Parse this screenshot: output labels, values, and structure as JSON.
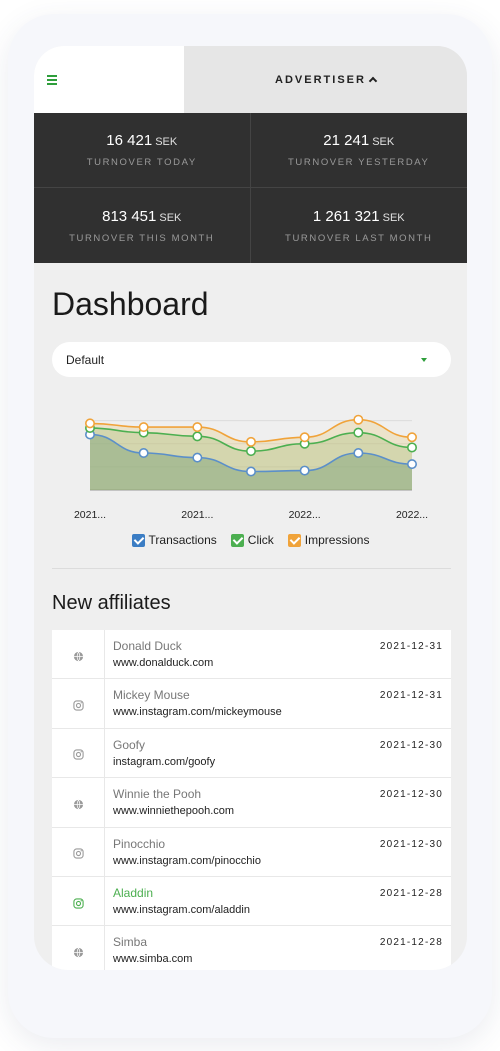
{
  "topbar": {
    "menu_icon": "hamburger-icon",
    "advertiser_label": "ADVERTISER",
    "caret_icon": "chevron-up-icon"
  },
  "stats": [
    {
      "value": "16 421",
      "unit": "SEK",
      "label": "TURNOVER TODAY"
    },
    {
      "value": "21 241",
      "unit": "SEK",
      "label": "TURNOVER YESTERDAY"
    },
    {
      "value": "813 451",
      "unit": "SEK",
      "label": "TURNOVER THIS MONTH"
    },
    {
      "value": "1 261 321",
      "unit": "SEK",
      "label": "TURNOVER LAST MONTH"
    }
  ],
  "dashboard": {
    "title": "Dashboard",
    "select_value": "Default"
  },
  "chart_data": {
    "type": "area",
    "x_tick_labels": [
      "2021...",
      "2021...",
      "2022...",
      "2022..."
    ],
    "series": [
      {
        "name": "Transactions",
        "color": "#5b8fc9",
        "values": [
          60,
          40,
          35,
          20,
          21,
          40,
          28
        ]
      },
      {
        "name": "Click",
        "color": "#4caf50",
        "values": [
          67,
          62,
          58,
          42,
          50,
          62,
          46
        ]
      },
      {
        "name": "Impressions",
        "color": "#f0a33a",
        "values": [
          72,
          68,
          68,
          52,
          57,
          76,
          57
        ]
      }
    ],
    "legend_position": "bottom",
    "grid": true
  },
  "legend": [
    {
      "label": "Transactions",
      "color": "#3b7dc4"
    },
    {
      "label": "Click",
      "color": "#4caf50"
    },
    {
      "label": "Impressions",
      "color": "#f0a33a"
    }
  ],
  "affiliates": {
    "title": "New affiliates",
    "rows": [
      {
        "name": "Donald Duck",
        "url": "www.donalduck.com",
        "date": "2021-12-31",
        "icon": "globe-icon"
      },
      {
        "name": "Mickey Mouse",
        "url": "www.instagram.com/mickeymouse",
        "date": "2021-12-31",
        "icon": "instagram-icon"
      },
      {
        "name": "Goofy",
        "url": "instagram.com/goofy",
        "date": "2021-12-30",
        "icon": "instagram-icon"
      },
      {
        "name": "Winnie the Pooh",
        "url": "www.winniethepooh.com",
        "date": "2021-12-30",
        "icon": "globe-icon"
      },
      {
        "name": "Pinocchio",
        "url": "www.instagram.com/pinocchio",
        "date": "2021-12-30",
        "icon": "instagram-icon"
      },
      {
        "name": "Aladdin",
        "url": "www.instagram.com/aladdin",
        "date": "2021-12-28",
        "icon": "instagram-icon",
        "highlight_color": "#4caf50"
      },
      {
        "name": "Simba",
        "url": "www.simba.com",
        "date": "2021-12-28",
        "icon": "globe-icon"
      }
    ]
  }
}
